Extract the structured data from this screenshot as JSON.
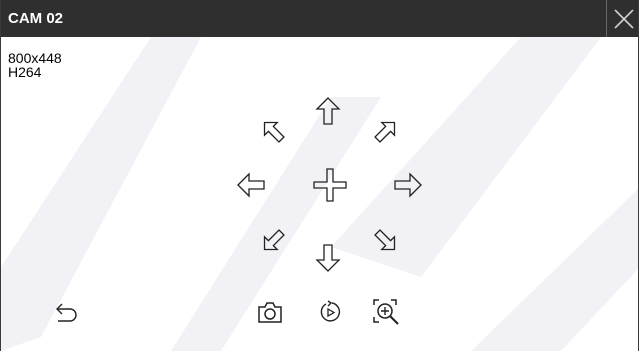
{
  "window": {
    "title": "CAM 02"
  },
  "stream_info": {
    "resolution": "800x448",
    "codec": "H264"
  },
  "ptz_controls": {
    "up": "arrow-up-icon",
    "down": "arrow-down-icon",
    "left": "arrow-left-icon",
    "right": "arrow-right-icon",
    "up_left": "arrow-up-left-icon",
    "up_right": "arrow-up-right-icon",
    "down_left": "arrow-down-left-icon",
    "down_right": "arrow-down-right-icon",
    "center": "crosshair-icon"
  },
  "toolbar": {
    "back": "back-icon",
    "snapshot": "camera-icon",
    "replay": "replay-icon",
    "zoom": "zoom-in-icon"
  },
  "colors": {
    "titlebar": "#2f2f2f",
    "title_text": "#ffffff",
    "background": "#ffffff",
    "icon": "#222222",
    "watermark": "#f0f0f4"
  }
}
